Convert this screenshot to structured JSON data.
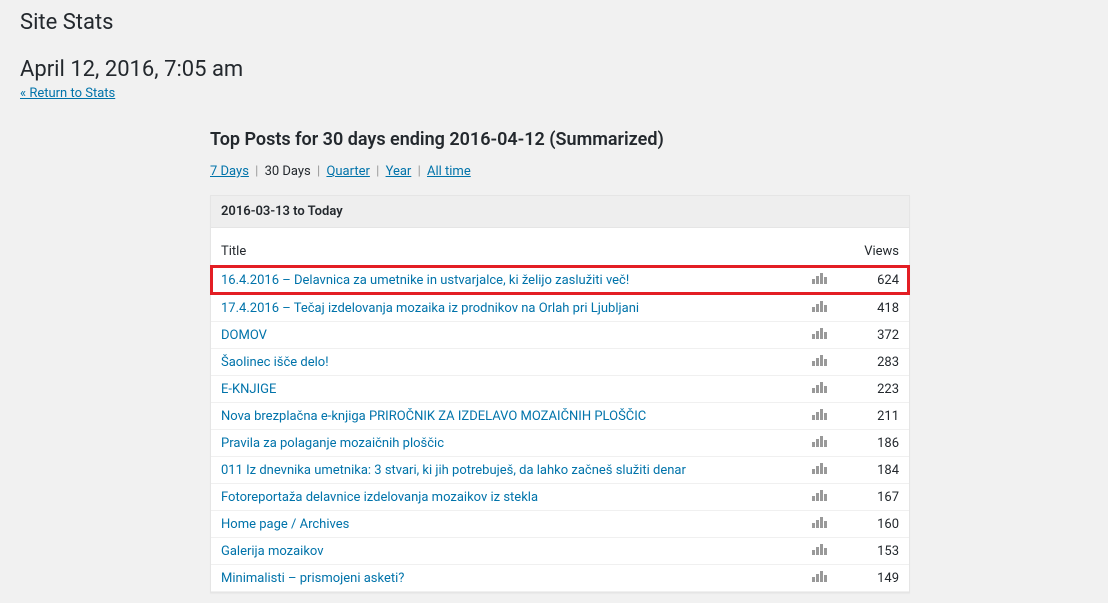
{
  "page_title": "Site Stats",
  "timestamp": "April 12, 2016, 7:05 am",
  "return_link": "« Return to Stats",
  "section_title": "Top Posts for 30 days ending 2016-04-12 (Summarized)",
  "ranges": {
    "days7": "7 Days",
    "days30": "30 Days",
    "quarter": "Quarter",
    "year": "Year",
    "alltime": "All time"
  },
  "date_range_label": "2016-03-13 to Today",
  "columns": {
    "title": "Title",
    "views": "Views"
  },
  "rows": [
    {
      "title": "16.4.2016 – Delavnica za umetnike in ustvarjalce, ki želijo zaslužiti več!",
      "views": 624,
      "highlighted": true
    },
    {
      "title": "17.4.2016 – Tečaj izdelovanja mozaika iz prodnikov na Orlah pri Ljubljani",
      "views": 418
    },
    {
      "title": "DOMOV",
      "views": 372
    },
    {
      "title": "Šaolinec išče delo!",
      "views": 283
    },
    {
      "title": "E-KNJIGE",
      "views": 223
    },
    {
      "title": "Nova brezplačna e-knjiga PRIROČNIK ZA IZDELAVO MOZAIČNIH PLOŠČIC",
      "views": 211
    },
    {
      "title": "Pravila za polaganje mozaičnih ploščic",
      "views": 186
    },
    {
      "title": "011 Iz dnevnika umetnika: 3 stvari, ki jih potrebuješ, da lahko začneš služiti denar",
      "views": 184
    },
    {
      "title": "Fotoreportaža delavnice izdelovanja mozaikov iz stekla",
      "views": 167
    },
    {
      "title": "Home page / Archives",
      "views": 160
    },
    {
      "title": "Galerija mozaikov",
      "views": 153
    },
    {
      "title": "Minimalisti – prismojeni asketi?",
      "views": 149
    }
  ]
}
